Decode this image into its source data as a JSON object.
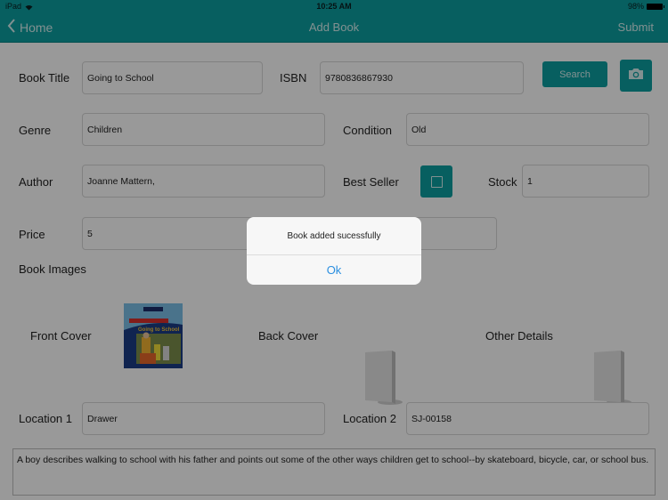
{
  "status_bar": {
    "device": "iPad",
    "time": "10:25 AM",
    "battery": "98%"
  },
  "nav": {
    "back_label": "Home",
    "title": "Add Book",
    "submit_label": "Submit"
  },
  "colors": {
    "accent": "#0c9ea0",
    "link": "#2b8fe0"
  },
  "form": {
    "book_title": {
      "label": "Book Title",
      "value": "Going to School"
    },
    "isbn": {
      "label": "ISBN",
      "value": "9780836867930"
    },
    "search_label": "Search",
    "camera_icon": "camera-icon",
    "genre": {
      "label": "Genre",
      "value": "Children"
    },
    "condition": {
      "label": "Condition",
      "value": "Old"
    },
    "author": {
      "label": "Author",
      "value": "Joanne Mattern,"
    },
    "best_seller": {
      "label": "Best Seller",
      "checked": false
    },
    "stock": {
      "label": "Stock",
      "value": "1"
    },
    "price": {
      "label": "Price",
      "value": "5"
    },
    "book_images_label": "Book Images",
    "images": [
      {
        "label": "Front Cover",
        "has_image": true
      },
      {
        "label": "Back Cover",
        "has_image": false
      },
      {
        "label": "Other Details",
        "has_image": false
      }
    ],
    "location1": {
      "label": "Location 1",
      "value": "Drawer"
    },
    "location2": {
      "label": "Location 2",
      "value": "SJ-00158"
    },
    "description": "A boy describes walking to school with his father and points out some of the other ways children get to school--by skateboard, bicycle, car, or school bus."
  },
  "alert": {
    "message": "Book added sucessfully",
    "ok_label": "Ok"
  }
}
